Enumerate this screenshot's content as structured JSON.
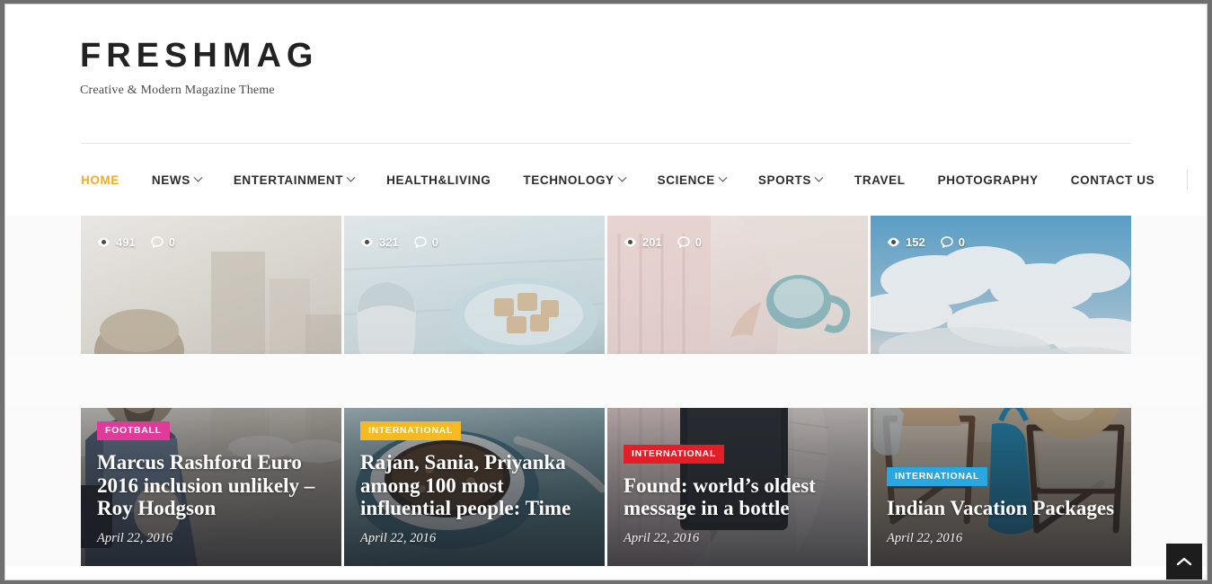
{
  "site": {
    "brand": "FRESHMAG",
    "tagline": "Creative & Modern Magazine Theme"
  },
  "nav": {
    "items": [
      {
        "label": "HOME",
        "has_dropdown": false,
        "active": true
      },
      {
        "label": "NEWS",
        "has_dropdown": true,
        "active": false
      },
      {
        "label": "ENTERTAINMENT",
        "has_dropdown": true,
        "active": false
      },
      {
        "label": "HEALTH&LIVING",
        "has_dropdown": false,
        "active": false
      },
      {
        "label": "TECHNOLOGY",
        "has_dropdown": true,
        "active": false
      },
      {
        "label": "SCIENCE",
        "has_dropdown": true,
        "active": false
      },
      {
        "label": "SPORTS",
        "has_dropdown": true,
        "active": false
      },
      {
        "label": "TRAVEL",
        "has_dropdown": false,
        "active": false
      },
      {
        "label": "PHOTOGRAPHY",
        "has_dropdown": false,
        "active": false
      },
      {
        "label": "CONTACT US",
        "has_dropdown": false,
        "active": false
      }
    ],
    "search_icon": "search-icon",
    "active_color": "#f0ad25"
  },
  "featured": {
    "cards": [
      {
        "views": "491",
        "comments": "0",
        "category": "FOOTBALL",
        "category_color": "#e03a9a",
        "title": "Marcus Rashford Euro 2016 inclusion unlikely – Roy Hodgson",
        "date": "April 22, 2016",
        "image_alt": "man-with-beanie-and-glasses-using-phone"
      },
      {
        "views": "321",
        "comments": "0",
        "category": "INTERNATIONAL",
        "category_color": "#f5b921",
        "title": "Rajan, Sania, Priyanka among 100 most influential people: Time",
        "date": "April 22, 2016",
        "image_alt": "coffee-cup-with-sugar-bowl-on-blue-table"
      },
      {
        "views": "201",
        "comments": "0",
        "category": "INTERNATIONAL",
        "category_color": "#e41e26",
        "title": "Found: world’s oldest message in a bottle",
        "date": "April 22, 2016",
        "image_alt": "woman-in-knit-socks-holding-mug-and-tablet"
      },
      {
        "views": "152",
        "comments": "0",
        "category": "INTERNATIONAL",
        "category_color": "#29a7e1",
        "title": "Indian Vacation Packages",
        "date": "April 22, 2016",
        "image_alt": "two-people-in-beach-chairs-facing-the-sea"
      }
    ],
    "icons": {
      "views": "eye-icon",
      "comments": "comment-bubble-icon"
    }
  },
  "back_to_top": {
    "icon": "chevron-up-icon",
    "label": ""
  }
}
